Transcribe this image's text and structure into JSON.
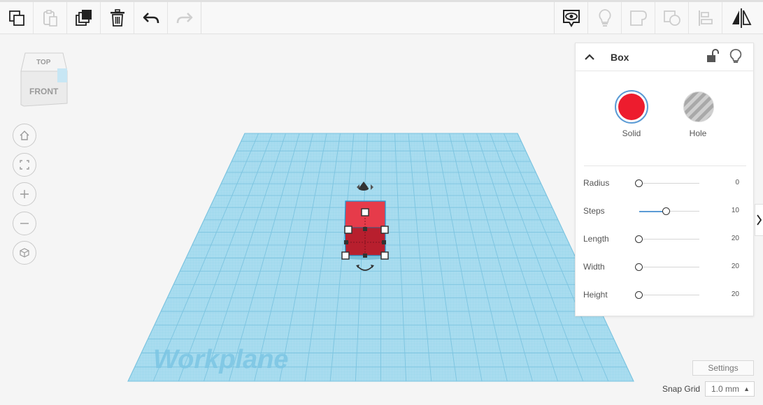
{
  "viewcube": {
    "top": "TOP",
    "front": "FRONT"
  },
  "workplane": {
    "label": "Workplane"
  },
  "inspector": {
    "title": "Box",
    "solid_label": "Solid",
    "hole_label": "Hole",
    "solid_color": "#ed1c2e",
    "properties": [
      {
        "label": "Radius",
        "value": "0",
        "level": 0.0
      },
      {
        "label": "Steps",
        "value": "10",
        "level": 0.45
      },
      {
        "label": "Length",
        "value": "20",
        "level": 0.0
      },
      {
        "label": "Width",
        "value": "20",
        "level": 0.0
      },
      {
        "label": "Height",
        "value": "20",
        "level": 0.0
      }
    ]
  },
  "footer": {
    "settings_label": "Settings",
    "snap_grid_label": "Snap Grid",
    "snap_grid_value": "1.0 mm"
  },
  "colors": {
    "grid_fill": "#a8dcef",
    "grid_line": "#7cc4e0",
    "box_front": "#b81f2e",
    "box_top": "#e63b4a",
    "accent": "#5b9bd5"
  },
  "icons": {
    "toolbar_left": [
      "copy-icon",
      "paste-icon",
      "duplicate-icon",
      "delete-icon",
      "undo-icon",
      "redo-icon"
    ],
    "toolbar_right": [
      "show-all-icon",
      "hide-icon",
      "group-icon",
      "ungroup-icon",
      "align-icon",
      "mirror-icon"
    ],
    "nav": [
      "home-view-icon",
      "fit-view-icon",
      "zoom-in-icon",
      "zoom-out-icon",
      "perspective-icon"
    ]
  }
}
